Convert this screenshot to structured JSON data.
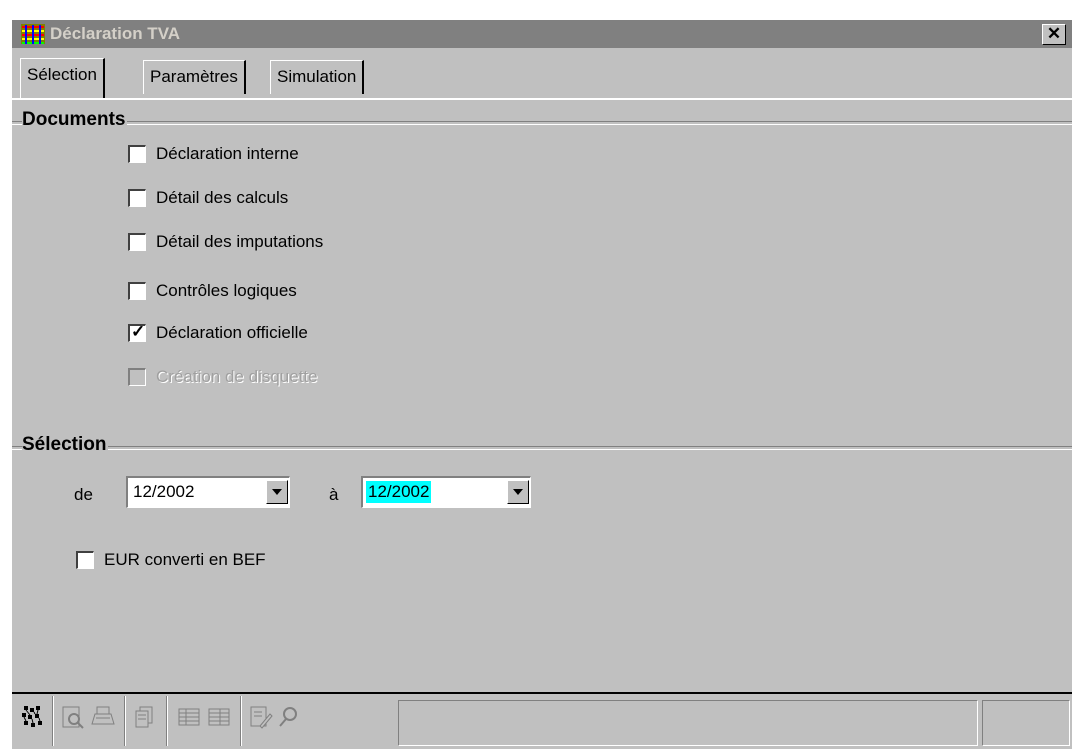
{
  "window": {
    "title": "Déclaration TVA",
    "close_label": "✕"
  },
  "tabs": [
    {
      "label": "Sélection",
      "active": true
    },
    {
      "label": "Paramètres",
      "active": false
    },
    {
      "label": "Simulation",
      "active": false
    }
  ],
  "documents": {
    "title": "Documents",
    "items": [
      {
        "label": "Déclaration interne",
        "checked": false,
        "enabled": true
      },
      {
        "label": "Détail des calculs",
        "checked": false,
        "enabled": true
      },
      {
        "label": "Détail des imputations",
        "checked": false,
        "enabled": true
      },
      {
        "label": "Contrôles logiques",
        "checked": false,
        "enabled": true
      },
      {
        "label": "Déclaration officielle",
        "checked": true,
        "enabled": true
      },
      {
        "label": "Création de disquette",
        "checked": false,
        "enabled": false
      }
    ]
  },
  "selection": {
    "title": "Sélection",
    "from_label": "de",
    "from_value": "12/2002",
    "to_label": "à",
    "to_value": "12/2002",
    "to_highlight_color": "#00ffff",
    "eur_label": "EUR converti en BEF",
    "eur_checked": false
  },
  "toolbar": {
    "icons": [
      "network-run-icon",
      "print-preview-icon",
      "print-icon",
      "copy-pages-icon",
      "table-icon",
      "table-alt-icon",
      "edit-document-icon",
      "search-icon"
    ]
  }
}
